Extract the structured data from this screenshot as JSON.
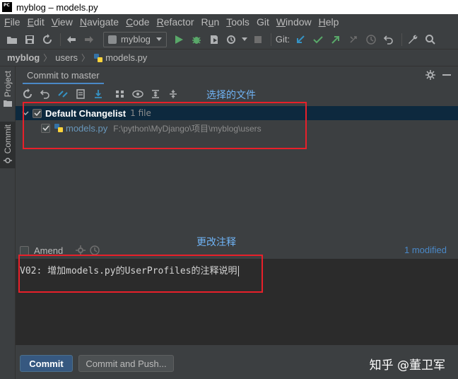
{
  "window": {
    "title": "myblog – models.py"
  },
  "menu": [
    "File",
    "Edit",
    "View",
    "Navigate",
    "Code",
    "Refactor",
    "Run",
    "Tools",
    "Git",
    "Window",
    "Help"
  ],
  "menu_mnemonics": [
    "F",
    "E",
    "V",
    "N",
    "C",
    "R",
    "u",
    "T",
    "",
    "W",
    "H"
  ],
  "toolbar": {
    "run_config": "myblog",
    "git_label": "Git:"
  },
  "breadcrumb": [
    "myblog",
    "users",
    "models.py"
  ],
  "side_tabs": {
    "project": "Project",
    "commit": "Commit"
  },
  "commit_panel": {
    "title": "Commit to master",
    "changelist": {
      "name": "Default Changelist",
      "count": "1 file"
    },
    "file": {
      "name": "models.py",
      "path": "F:\\python\\MyDjango\\项目\\myblog\\users"
    },
    "amend_label": "Amend",
    "modified": "1 modified",
    "message": "V02: 增加models.py的UserProfiles的注释说明",
    "commit_button": "Commit",
    "commit_push_button": "Commit and Push..."
  },
  "annotations": {
    "selected_files": "选择的文件",
    "change_comment": "更改注释"
  },
  "watermark": "知乎 @董卫军",
  "colors": {
    "accent": "#4a88c7",
    "highlight_box": "#e8202a",
    "run": "#59a869"
  }
}
